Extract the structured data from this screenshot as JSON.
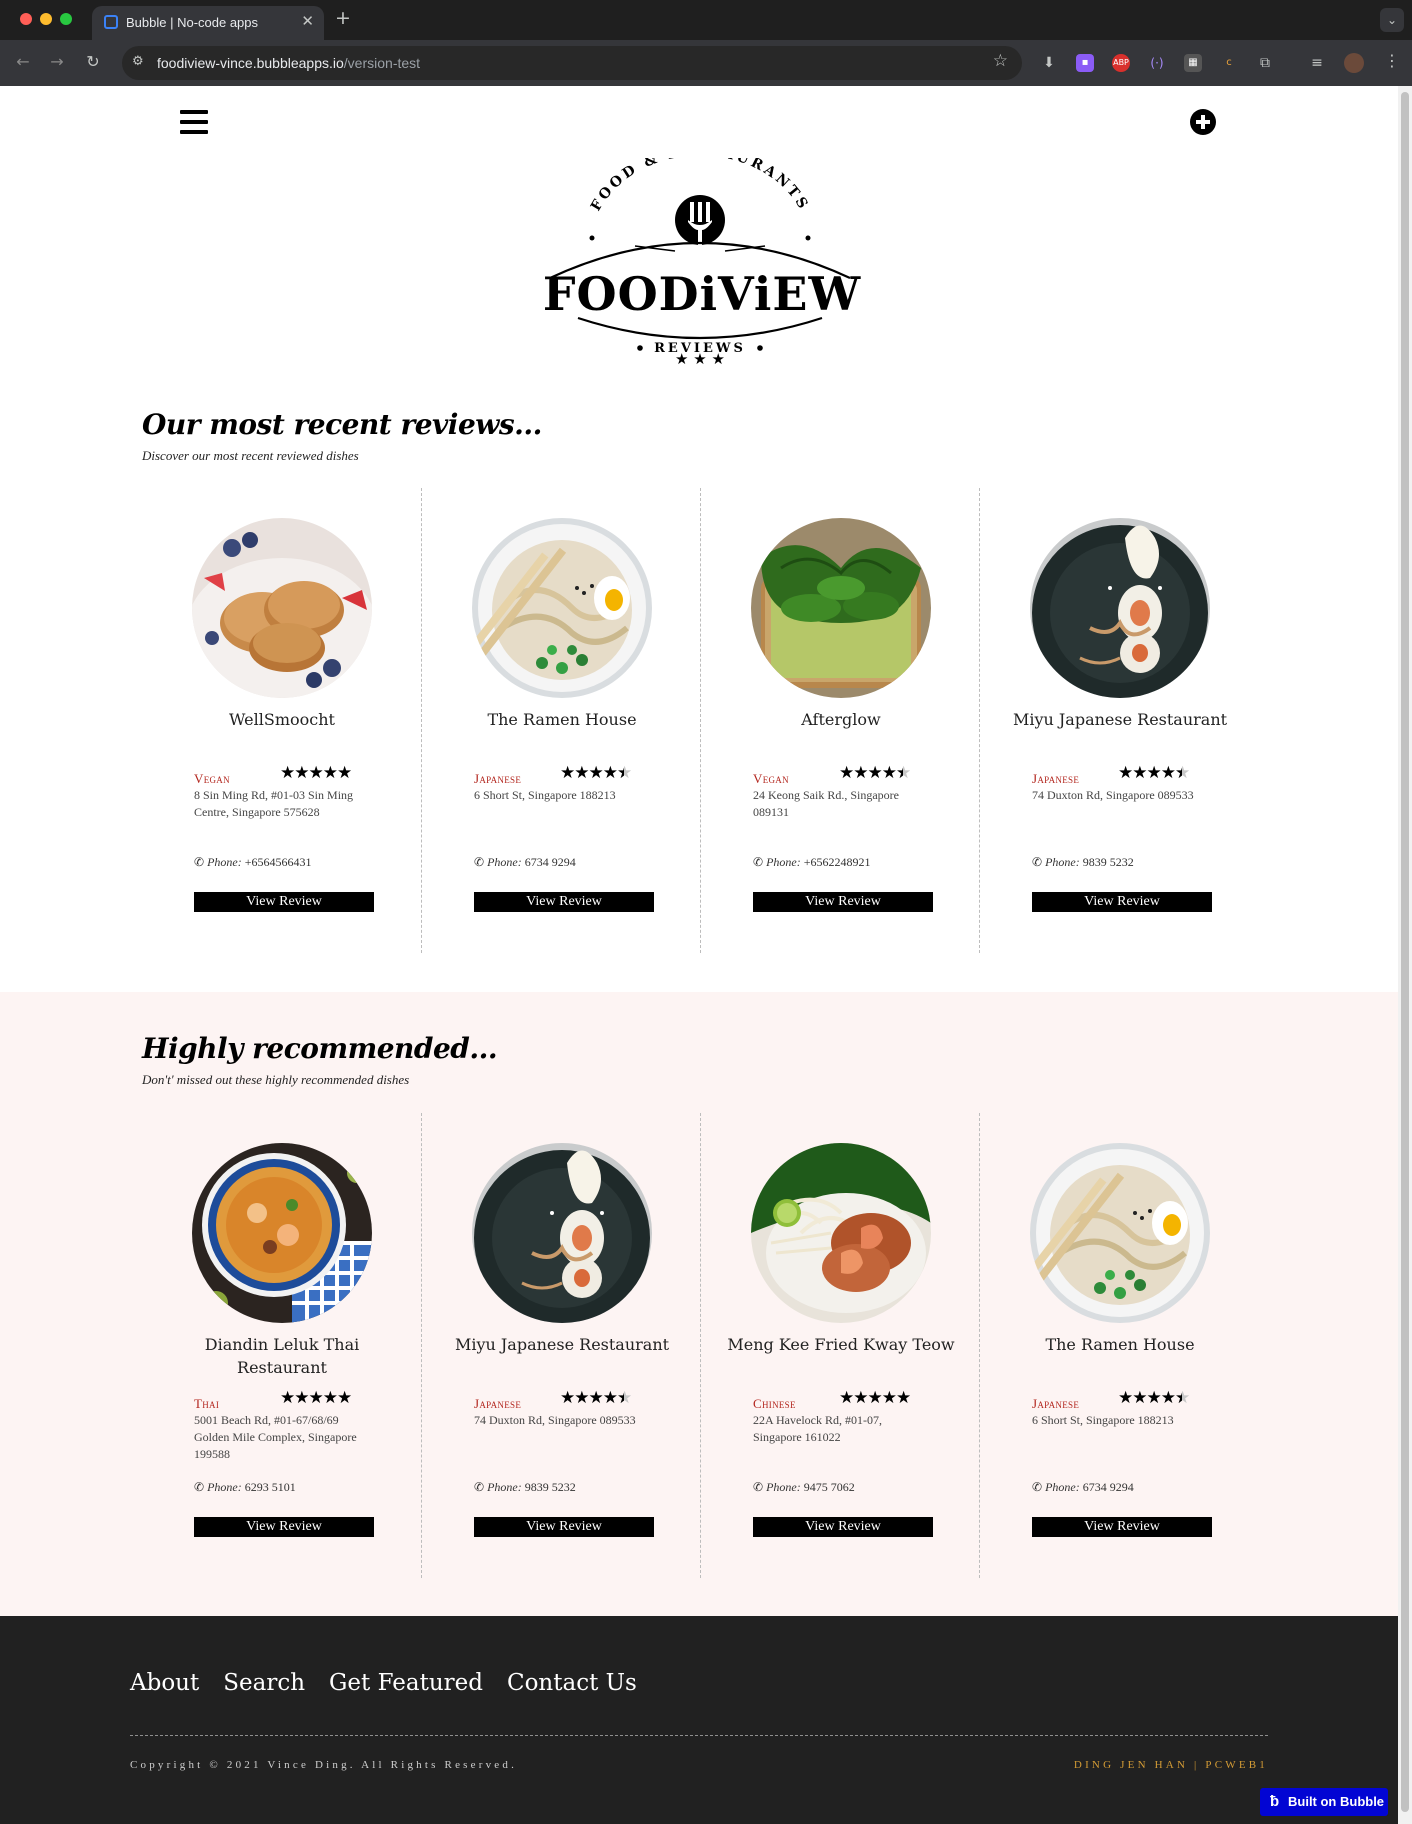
{
  "browser": {
    "tab_title": "Bubble | No-code apps",
    "url_host": "foodiview-vince.bubbleapps.io",
    "url_path": "/version-test"
  },
  "logo": {
    "top_arc": "FOOD & RESTAURANTS",
    "brand": "FOODiViEW",
    "bottom": "REVIEWS",
    "stars": "★ ★ ★"
  },
  "recent": {
    "title": "Our most recent reviews...",
    "subtitle": "Discover our most recent reviewed dishes",
    "cards": [
      {
        "name": "WellSmoocht",
        "cuisine": "Vegan",
        "rating": 5,
        "address": "8 Sin Ming Rd, #01-03 Sin Ming Centre, Singapore 575628",
        "phone_label": "Phone:",
        "phone": "+6564566431",
        "button": "View Review",
        "photo": "pancakes"
      },
      {
        "name": "The Ramen House",
        "cuisine": "Japanese",
        "rating": 4.5,
        "address": "6 Short St, Singapore 188213",
        "phone_label": "Phone:",
        "phone": "6734 9294",
        "button": "View Review",
        "photo": "ramen"
      },
      {
        "name": "Afterglow",
        "cuisine": "Vegan",
        "rating": 4.5,
        "address": "24 Keong Saik Rd., Singapore 089131",
        "phone_label": "Phone:",
        "phone": "+6562248921",
        "button": "View Review",
        "photo": "avocado-toast"
      },
      {
        "name": "Miyu Japanese Restaurant",
        "cuisine": "Japanese",
        "rating": 4.5,
        "address": "74 Duxton Rd, Singapore 089533",
        "phone_label": "Phone:",
        "phone": "9839 5232",
        "button": "View Review",
        "photo": "sushi"
      }
    ]
  },
  "recommended": {
    "title": "Highly recommended...",
    "subtitle": "Don't' missed out these highly recommended dishes",
    "cards": [
      {
        "name": "Diandin Leluk Thai Restaurant",
        "cuisine": "Thai",
        "rating": 5,
        "address": "5001 Beach Rd, #01-67/68/69 Golden Mile Complex, Singapore 199588",
        "phone_label": "Phone:",
        "phone": "6293 5101",
        "button": "View Review",
        "photo": "tom-yum"
      },
      {
        "name": "Miyu Japanese Restaurant",
        "cuisine": "Japanese",
        "rating": 4.5,
        "address": "74 Duxton Rd, Singapore 089533",
        "phone_label": "Phone:",
        "phone": "9839 5232",
        "button": "View Review",
        "photo": "sushi"
      },
      {
        "name": "Meng Kee Fried Kway Teow",
        "cuisine": "Chinese",
        "rating": 5,
        "address": "22A Havelock Rd, #01-07, Singapore 161022",
        "phone_label": "Phone:",
        "phone": "9475 7062",
        "button": "View Review",
        "photo": "kway-teow"
      },
      {
        "name": "The Ramen House",
        "cuisine": "Japanese",
        "rating": 4.5,
        "address": "6 Short St, Singapore 188213",
        "phone_label": "Phone:",
        "phone": "6734 9294",
        "button": "View Review",
        "photo": "ramen"
      }
    ]
  },
  "footer": {
    "links": [
      "About",
      "Search",
      "Get Featured",
      "Contact Us"
    ],
    "copyright": "Copyright © 2021 Vince Ding. All Rights Reserved.",
    "credit": "DING JEN HAN | PCWEB1",
    "badge": "Built on Bubble"
  },
  "icons": {
    "menu": "hamburger-icon",
    "add": "plus-circle-icon",
    "phone": "phone-icon"
  },
  "colors": {
    "cuisine": "#b3261e",
    "recommended_bg": "#fdf4f3",
    "footer_bg": "#212121",
    "credit": "#d39b35",
    "bubble_badge": "#0205d3"
  }
}
